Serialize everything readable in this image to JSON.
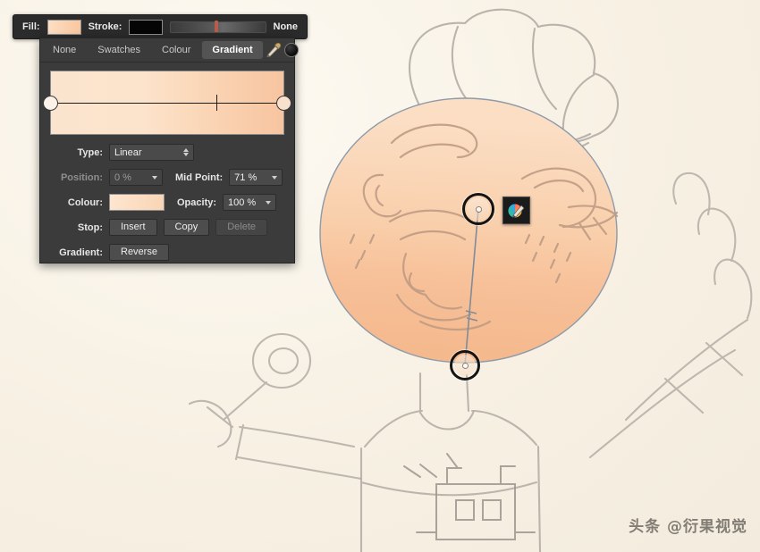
{
  "app": {
    "canvas_bg": "#f7f0e3",
    "panel_bg": "#3b3b3b",
    "accent": "#f9c79f"
  },
  "fill_bar": {
    "fill_label": "Fill:",
    "fill_swatch_color": "#fbd9bb",
    "stroke_label": "Stroke:",
    "stroke_swatch_color": "#050505",
    "stroke_width_none_label": "None",
    "slider_name": "stroke-width-slider"
  },
  "panel": {
    "tabs": [
      {
        "label": "None",
        "active": false
      },
      {
        "label": "Swatches",
        "active": false
      },
      {
        "label": "Colour",
        "active": false
      },
      {
        "label": "Gradient",
        "active": true
      }
    ],
    "tools": {
      "eyedropper_icon": "eyedropper-icon",
      "colour_dot_icon": "colour-dot-icon",
      "colour_dot_color": "#101010"
    },
    "gradient_strip": {
      "start_color": "#fbe4cf",
      "end_color": "#f7c4a0",
      "mid_point_position": "71%",
      "stop_a_name": "gradient-stop-start",
      "stop_b_name": "gradient-stop-end"
    },
    "form": {
      "type_label": "Type:",
      "type_value": "Linear",
      "position_label": "Position:",
      "position_value": "0 %",
      "mid_point_label": "Mid Point:",
      "mid_point_value": "71 %",
      "colour_label": "Colour:",
      "colour_value": "#fbdcc0",
      "opacity_label": "Opacity:",
      "opacity_value": "100 %",
      "stop_label": "Stop:",
      "stop_insert": "Insert",
      "stop_copy": "Copy",
      "stop_delete": "Delete",
      "gradient_label": "Gradient:",
      "gradient_reverse": "Reverse"
    }
  },
  "canvas": {
    "artwork_name": "chef-character-sketch",
    "gradient_handle_top": "gradient-handle-start",
    "gradient_handle_bottom": "gradient-handle-end",
    "colour_wheel_button": "colour-wheel-button"
  },
  "watermark": {
    "text": "头条 @衍果视觉"
  }
}
